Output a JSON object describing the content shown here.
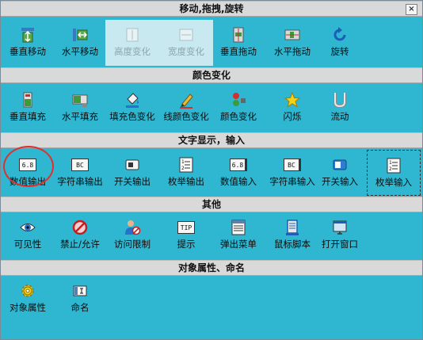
{
  "window": {
    "close_glyph": "×"
  },
  "sections": [
    {
      "title": "移动,拖拽,旋转",
      "items": [
        {
          "label": "垂直移动",
          "icon": "vertical-move-icon"
        },
        {
          "label": "水平移动",
          "icon": "horizontal-move-icon"
        },
        {
          "label": "高度变化",
          "icon": "height-change-icon",
          "disabled": true
        },
        {
          "label": "宽度变化",
          "icon": "width-change-icon",
          "disabled": true
        },
        {
          "label": "垂直拖动",
          "icon": "vertical-drag-icon"
        },
        {
          "label": "水平拖动",
          "icon": "horizontal-drag-icon"
        },
        {
          "label": "旋转",
          "icon": "rotate-icon"
        }
      ]
    },
    {
      "title": "颜色变化",
      "items": [
        {
          "label": "垂直填充",
          "icon": "vertical-fill-icon"
        },
        {
          "label": "水平填充",
          "icon": "horizontal-fill-icon"
        },
        {
          "label": "填充色变化",
          "icon": "fill-color-icon"
        },
        {
          "label": "线颜色变化",
          "icon": "line-color-icon"
        },
        {
          "label": "颜色变化",
          "icon": "color-change-icon"
        },
        {
          "label": "闪烁",
          "icon": "blink-icon"
        },
        {
          "label": "流动",
          "icon": "flow-icon"
        }
      ]
    },
    {
      "title": "文字显示，输入",
      "items": [
        {
          "label": "数值输出",
          "icon": "numeric-output-icon",
          "tag": "6.8"
        },
        {
          "label": "字符串输出",
          "icon": "string-output-icon",
          "tag": "BC"
        },
        {
          "label": "开关输出",
          "icon": "switch-output-icon"
        },
        {
          "label": "枚举输出",
          "icon": "enum-output-icon"
        },
        {
          "label": "数值输入",
          "icon": "numeric-input-icon",
          "tag": "6.8"
        },
        {
          "label": "字符串输入",
          "icon": "string-input-icon",
          "tag": "BC"
        },
        {
          "label": "开关输入",
          "icon": "switch-input-icon"
        },
        {
          "label": "枚举输入",
          "icon": "enum-input-icon"
        }
      ]
    },
    {
      "title": "其他",
      "items": [
        {
          "label": "可见性",
          "icon": "eye-icon"
        },
        {
          "label": "禁止/允许",
          "icon": "forbid-icon"
        },
        {
          "label": "访问限制",
          "icon": "access-limit-icon"
        },
        {
          "label": "提示",
          "icon": "tip-icon",
          "tag": "TIP"
        },
        {
          "label": "弹出菜单",
          "icon": "popup-menu-icon"
        },
        {
          "label": "鼠标脚本",
          "icon": "mouse-script-icon"
        },
        {
          "label": "打开窗口",
          "icon": "open-window-icon"
        }
      ]
    },
    {
      "title": "对象属性、命名",
      "items": [
        {
          "label": "对象属性",
          "icon": "gear-icon"
        },
        {
          "label": "命名",
          "icon": "name-icon"
        }
      ]
    }
  ]
}
